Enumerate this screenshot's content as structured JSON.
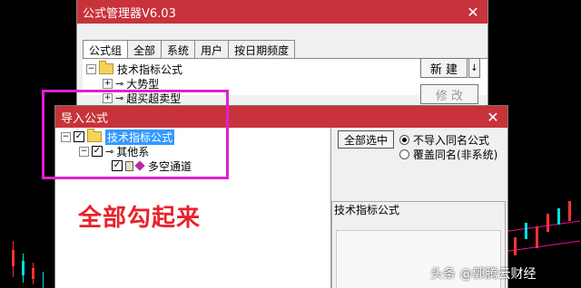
{
  "main_window": {
    "title": "公式管理器V6.03",
    "close_glyph": "✕",
    "tabs": [
      {
        "label": "公式组",
        "active": true
      },
      {
        "label": "全部",
        "active": false
      },
      {
        "label": "系统",
        "active": false
      },
      {
        "label": "用户",
        "active": false
      },
      {
        "label": "按日期频度",
        "active": false
      }
    ],
    "tree": [
      {
        "label": "技术指标公式",
        "expander": "−",
        "icon": "folder-icon"
      },
      {
        "label": "大势型",
        "expander": "+",
        "icon": "key-icon"
      },
      {
        "label": "超买超卖型",
        "expander": "+",
        "icon": "key-icon"
      }
    ],
    "buttons": {
      "new_label": "新 建",
      "new_dropdown": "↓",
      "edit_label": "修 改"
    }
  },
  "import_dialog": {
    "title": "导入公式",
    "close_glyph": "✕",
    "tree": [
      {
        "label": "技术指标公式",
        "expander": "−",
        "checked": true,
        "selected": true,
        "icon": "folder-icon"
      },
      {
        "label": "其他系",
        "expander": "−",
        "checked": true,
        "selected": false,
        "icon": "key-icon"
      },
      {
        "label": "多空通道",
        "expander": "",
        "checked": true,
        "selected": false,
        "icon": "diamond-icon"
      }
    ],
    "select_all_label": "全部选中",
    "radio_options": [
      {
        "label": "不导入同名公式",
        "selected": true
      },
      {
        "label": "覆盖同名(非系统)",
        "selected": false
      }
    ],
    "info_label": "技术指标公式",
    "check_glyph": "✓"
  },
  "annotation": {
    "text": "全部勾起来",
    "color": "#e8222a"
  },
  "highlight_color": "#e020d0",
  "watermark": "头条 @郭腾云财经",
  "colors": {
    "titlebar": "#c8323a",
    "selection": "#3399ff"
  }
}
